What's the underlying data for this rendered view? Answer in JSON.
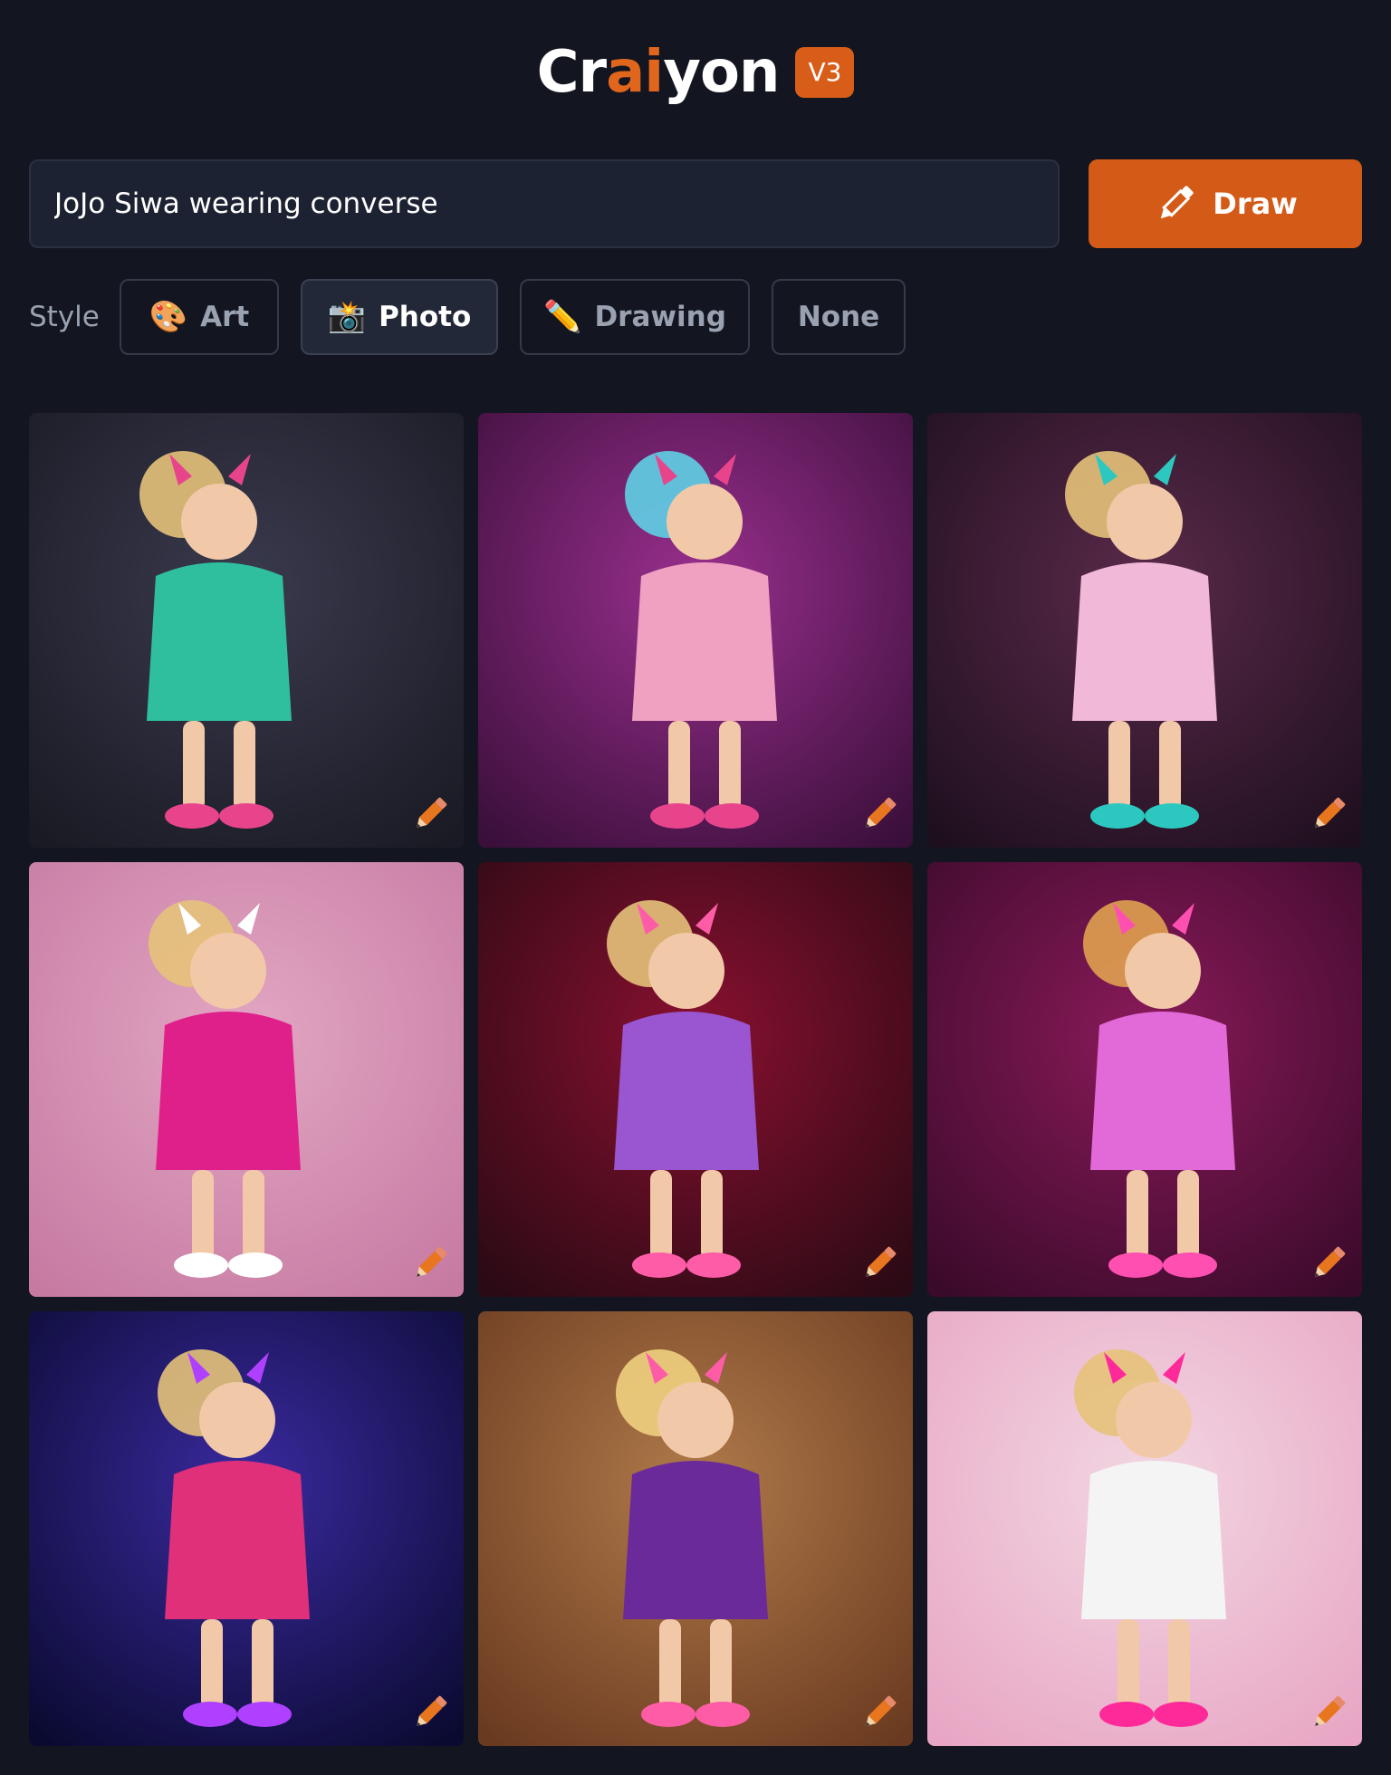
{
  "header": {
    "logo_part1": "Cr",
    "logo_part2": "ai",
    "logo_part3": "yon",
    "version": "V3"
  },
  "prompt": {
    "value": "JoJo Siwa wearing converse",
    "draw_label": "Draw"
  },
  "style": {
    "label": "Style",
    "options": [
      {
        "label": "Art",
        "icon": "palette-icon",
        "selected": false
      },
      {
        "label": "Photo",
        "icon": "camera-flash-icon",
        "selected": true
      },
      {
        "label": "Drawing",
        "icon": "pencil-icon",
        "selected": false
      },
      {
        "label": "None",
        "selected": false
      }
    ]
  },
  "colors": {
    "background": "#131620",
    "accent": "#d35a17",
    "input_bg": "#1d2232"
  },
  "images": [
    {
      "name": "image-1",
      "bg": [
        "#3a3a4e",
        "#1a1a24"
      ],
      "hair": "#e6c27a",
      "outfit": "#2fbf9f",
      "accent": "#e8448c"
    },
    {
      "name": "image-2",
      "bg": [
        "#9a2f8e",
        "#3a0f3a"
      ],
      "hair": "#5fd0e6",
      "outfit": "#f0a0c0",
      "accent": "#e8448c"
    },
    {
      "name": "image-3",
      "bg": [
        "#5a2a4a",
        "#1e0f1e"
      ],
      "hair": "#e6c27a",
      "outfit": "#f2b8d8",
      "accent": "#2cc8c0"
    },
    {
      "name": "image-4",
      "bg": [
        "#e2a6c2",
        "#c67aa2"
      ],
      "hair": "#e6c27a",
      "outfit": "#e0208a",
      "accent": "#ffffff"
    },
    {
      "name": "image-5",
      "bg": [
        "#8a1030",
        "#2a0a14"
      ],
      "hair": "#e6c27a",
      "outfit": "#9a55d0",
      "accent": "#ff5ca8"
    },
    {
      "name": "image-6",
      "bg": [
        "#8a1a5a",
        "#3a0a2a"
      ],
      "hair": "#e0a050",
      "outfit": "#e26ad8",
      "accent": "#ff4fb0"
    },
    {
      "name": "image-7",
      "bg": [
        "#3a2aa0",
        "#0a0a30"
      ],
      "hair": "#e6c27a",
      "outfit": "#e0307a",
      "accent": "#b040ff"
    },
    {
      "name": "image-8",
      "bg": [
        "#b07a4a",
        "#6a3a20"
      ],
      "hair": "#f0d080",
      "outfit": "#6a2a9a",
      "accent": "#ff5ca8"
    },
    {
      "name": "image-9",
      "bg": [
        "#f2d6e2",
        "#e8a6c4"
      ],
      "hair": "#e6c27a",
      "outfit": "#f4f4f4",
      "accent": "#ff2a9a"
    }
  ]
}
